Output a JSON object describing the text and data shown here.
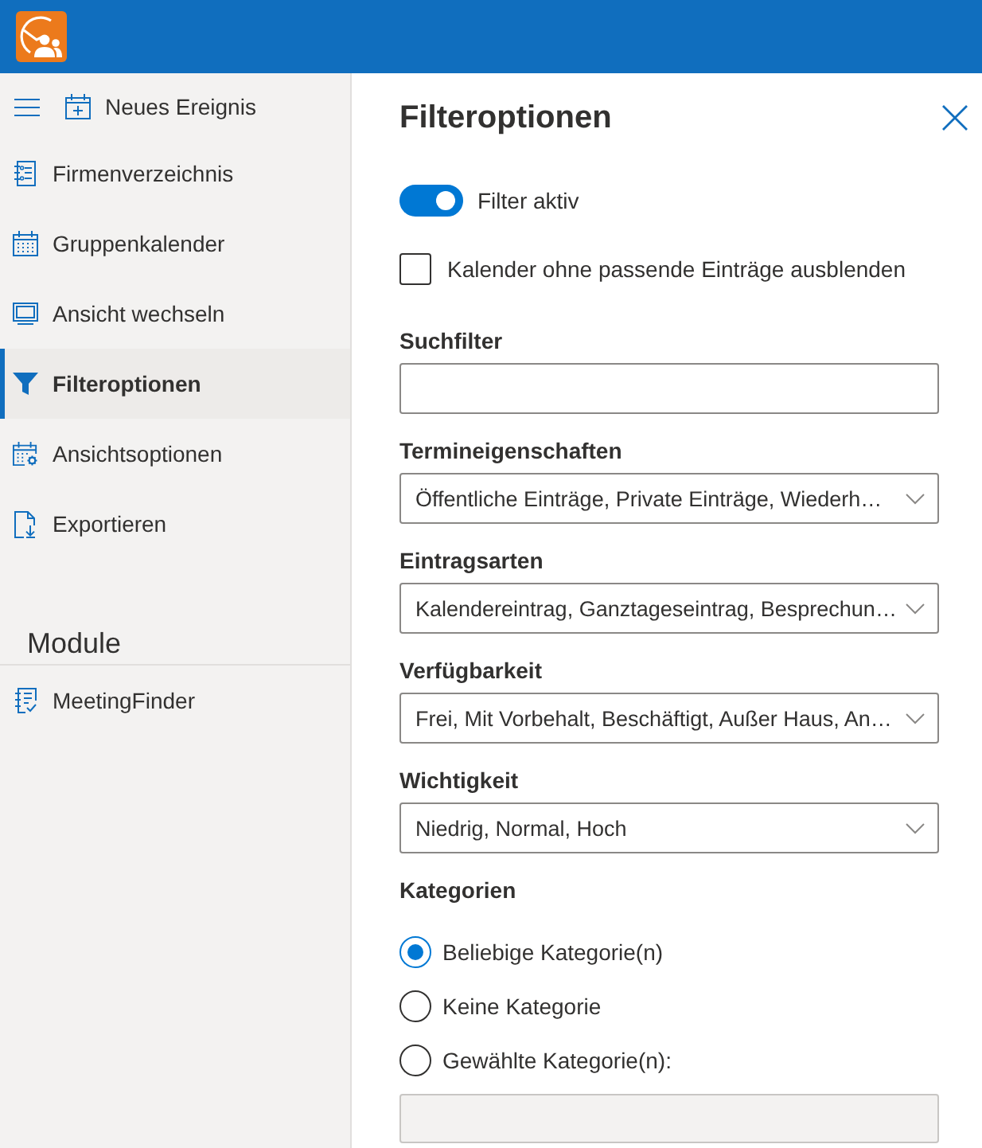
{
  "sidebar": {
    "new_event": "Neues Ereignis",
    "items": [
      {
        "label": "Firmenverzeichnis",
        "selected": false
      },
      {
        "label": "Gruppenkalender",
        "selected": false
      },
      {
        "label": "Ansicht wechseln",
        "selected": false
      },
      {
        "label": "Filteroptionen",
        "selected": true
      },
      {
        "label": "Ansichtsoptionen",
        "selected": false
      },
      {
        "label": "Exportieren",
        "selected": false
      }
    ],
    "section_title": "Module",
    "module_items": [
      {
        "label": "MeetingFinder",
        "selected": false
      }
    ]
  },
  "panel": {
    "title": "Filteroptionen",
    "filter_toggle": {
      "label": "Filter aktiv",
      "on": true
    },
    "hide_empty_calendars": {
      "label": "Kalender ohne passende Einträge ausblenden",
      "checked": false
    },
    "search": {
      "label": "Suchfilter"
    },
    "dropdowns": [
      {
        "label": "Termineigenschaften",
        "value": "Öffentliche Einträge, Private Einträge, Wiederh…"
      },
      {
        "label": "Eintragsarten",
        "value": "Kalendereintrag, Ganztageseintrag, Besprechun…"
      },
      {
        "label": "Verfügbarkeit",
        "value": "Frei, Mit Vorbehalt, Beschäftigt, Außer Haus, An…"
      },
      {
        "label": "Wichtigkeit",
        "value": "Niedrig, Normal, Hoch"
      }
    ],
    "categories": {
      "label": "Kategorien",
      "options": [
        {
          "label": "Beliebige Kategorie(n)",
          "selected": true
        },
        {
          "label": "Keine Kategorie",
          "selected": false
        },
        {
          "label": "Gewählte Kategorie(n):",
          "selected": false
        }
      ],
      "field": {
        "disabled": true
      }
    }
  }
}
